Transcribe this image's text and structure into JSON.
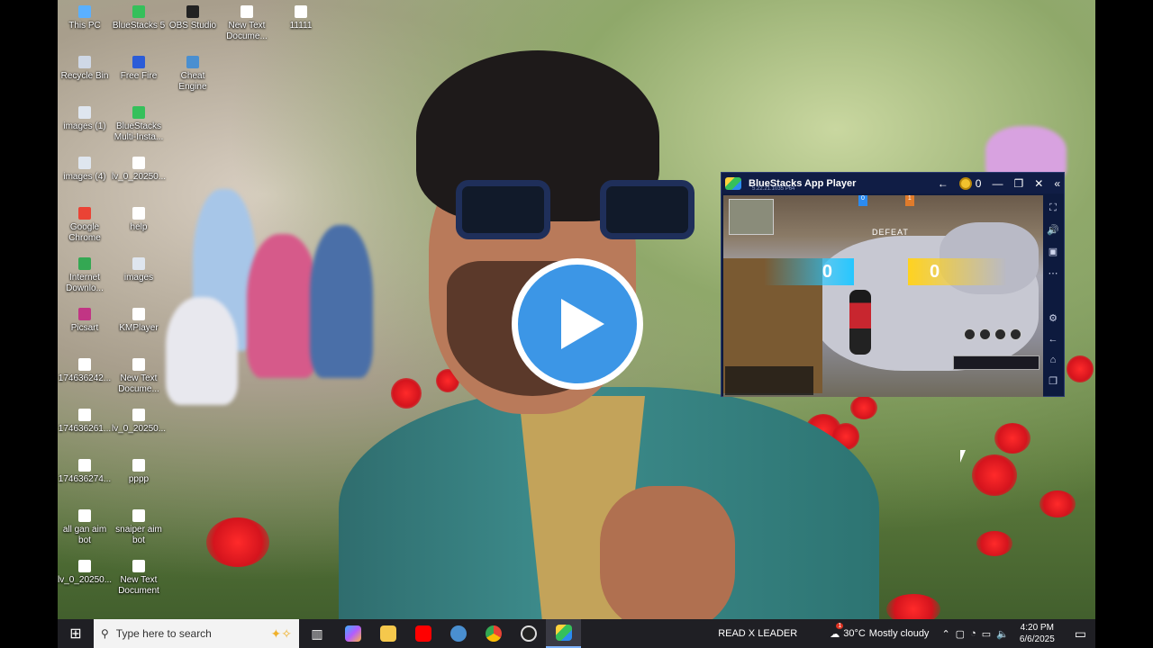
{
  "desktop": {
    "icons_col1": [
      {
        "label": "This PC",
        "icon": "this-pc-icon",
        "color": "#5ab0ff"
      },
      {
        "label": "Recycle Bin",
        "icon": "recycle-bin-icon",
        "color": "#cfd8e6"
      },
      {
        "label": "images (1)",
        "icon": "image-file-icon",
        "color": "#dfe6ef"
      },
      {
        "label": "images (4)",
        "icon": "image-file-icon",
        "color": "#dfe6ef"
      },
      {
        "label": "Google Chrome",
        "icon": "chrome-icon",
        "color": "#ea4335"
      },
      {
        "label": "Internet Downlo...",
        "icon": "idm-icon",
        "color": "#34a853"
      },
      {
        "label": "Picsart",
        "icon": "picsart-icon",
        "color": "#c13584"
      },
      {
        "label": "174636242...",
        "icon": "document-icon",
        "color": "#ffffff"
      },
      {
        "label": "174636261...",
        "icon": "document-icon",
        "color": "#ffffff"
      },
      {
        "label": "174636274...",
        "icon": "document-icon",
        "color": "#ffffff"
      },
      {
        "label": "all gan aim bot",
        "icon": "text-file-icon",
        "color": "#ffffff"
      },
      {
        "label": "lv_0_20250...",
        "icon": "document-icon",
        "color": "#ffffff"
      }
    ],
    "icons_col2": [
      {
        "label": "BlueStacks 5",
        "icon": "bluestacks-icon",
        "color": "#35c05b"
      },
      {
        "label": "Free Fire",
        "icon": "free-fire-icon",
        "color": "#2b5cd8"
      },
      {
        "label": "BlueStacks Multi-Insta...",
        "icon": "bluestacks-multi-icon",
        "color": "#35c05b"
      },
      {
        "label": "lv_0_20250...",
        "icon": "document-icon",
        "color": "#ffffff"
      },
      {
        "label": "help",
        "icon": "help-file-icon",
        "color": "#ffffff"
      },
      {
        "label": "images",
        "icon": "image-file-icon",
        "color": "#dfe6ef"
      },
      {
        "label": "KMPlayer",
        "icon": "kmplayer-icon",
        "color": "#ffffff"
      },
      {
        "label": "New Text Docume...",
        "icon": "text-file-icon",
        "color": "#ffffff"
      },
      {
        "label": "lv_0_20250...",
        "icon": "document-icon",
        "color": "#ffffff"
      },
      {
        "label": "pppp",
        "icon": "document-icon",
        "color": "#ffffff"
      },
      {
        "label": "snaiper aim bot",
        "icon": "text-file-icon",
        "color": "#ffffff"
      },
      {
        "label": "New Text Document",
        "icon": "text-file-icon",
        "color": "#ffffff"
      }
    ],
    "icons_row_top": [
      {
        "label": "OBS Studio",
        "icon": "obs-icon",
        "color": "#222222"
      },
      {
        "label": "Cheat Engine",
        "icon": "cheat-engine-icon",
        "color": "#4a8fd0"
      },
      {
        "label": "New Text Docume...",
        "icon": "text-file-icon",
        "color": "#ffffff"
      },
      {
        "label": "11111",
        "icon": "text-file-icon",
        "color": "#ffffff"
      }
    ]
  },
  "bluestacks": {
    "title": "BlueStacks App Player",
    "version": "5.22.21.1035  P64",
    "coins": "0",
    "game": {
      "defeat_label": "DEFEAT",
      "score_blue": "0",
      "score_yellow": "0",
      "team_blue": "0",
      "team_orange": "1"
    }
  },
  "taskbar": {
    "search_placeholder": "Type here to search",
    "notification_text": "READ X LEADER",
    "weather_temp": "30°C",
    "weather_desc": "Mostly cloudy",
    "time": "4:20 PM",
    "date": "6/6/2025",
    "weather_badge": "1"
  }
}
